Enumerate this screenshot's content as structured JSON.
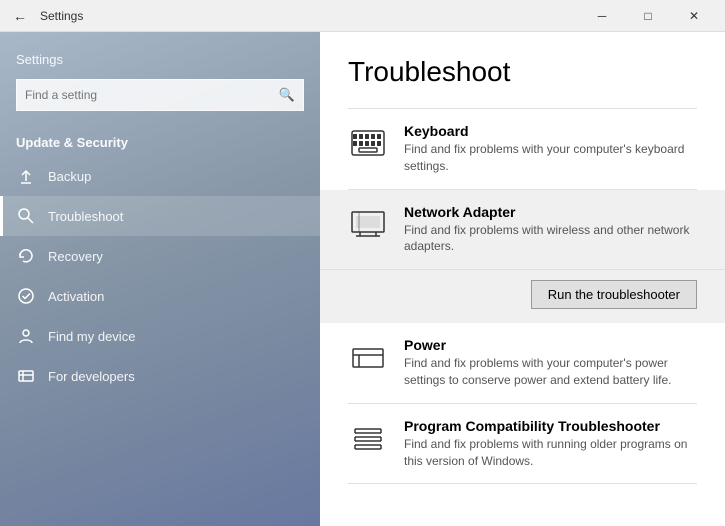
{
  "titlebar": {
    "title": "Settings",
    "min_label": "─",
    "max_label": "□",
    "close_label": "✕"
  },
  "sidebar": {
    "search_placeholder": "Find a setting",
    "section_label": "Update & Security",
    "nav_items": [
      {
        "id": "backup",
        "label": "Backup",
        "icon": "↑"
      },
      {
        "id": "troubleshoot",
        "label": "Troubleshoot",
        "icon": "🔑",
        "active": true
      },
      {
        "id": "recovery",
        "label": "Recovery",
        "icon": "↺"
      },
      {
        "id": "activation",
        "label": "Activation",
        "icon": "✓"
      },
      {
        "id": "find-my-device",
        "label": "Find my device",
        "icon": "👤"
      },
      {
        "id": "for-developers",
        "label": "For developers",
        "icon": "⚙"
      }
    ]
  },
  "main": {
    "title": "Troubleshoot",
    "items": [
      {
        "id": "keyboard",
        "name": "Keyboard",
        "desc": "Find and fix problems with your computer's keyboard settings.",
        "icon": "⌨",
        "selected": false
      },
      {
        "id": "network-adapter",
        "name": "Network Adapter",
        "desc": "Find and fix problems with wireless and other network adapters.",
        "icon": "🖥",
        "selected": true
      },
      {
        "id": "power",
        "name": "Power",
        "desc": "Find and fix problems with your computer's power settings to conserve power and extend battery life.",
        "icon": "□",
        "selected": false
      },
      {
        "id": "program-compat",
        "name": "Program Compatibility Troubleshooter",
        "desc": "Find and fix problems with running older programs on this version of Windows.",
        "icon": "≡",
        "selected": false
      }
    ],
    "run_btn_label": "Run the troubleshooter"
  }
}
